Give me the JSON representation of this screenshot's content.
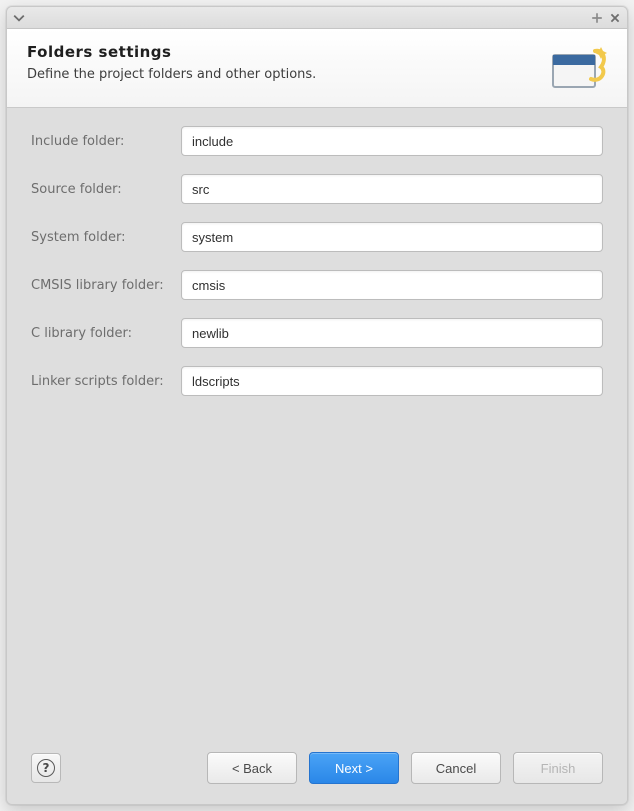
{
  "header": {
    "title": "Folders  settings",
    "subtitle": "Define the project folders and other options."
  },
  "fields": {
    "include": {
      "label": "Include folder:",
      "value": "include"
    },
    "source": {
      "label": "Source folder:",
      "value": "src"
    },
    "system": {
      "label": "System folder:",
      "value": "system"
    },
    "cmsis": {
      "label": "CMSIS library folder:",
      "value": "cmsis"
    },
    "clib": {
      "label": "C library folder:",
      "value": "newlib"
    },
    "linker": {
      "label": "Linker scripts folder:",
      "value": "ldscripts"
    }
  },
  "buttons": {
    "back": "< Back",
    "next": "Next >",
    "cancel": "Cancel",
    "finish": "Finish"
  }
}
